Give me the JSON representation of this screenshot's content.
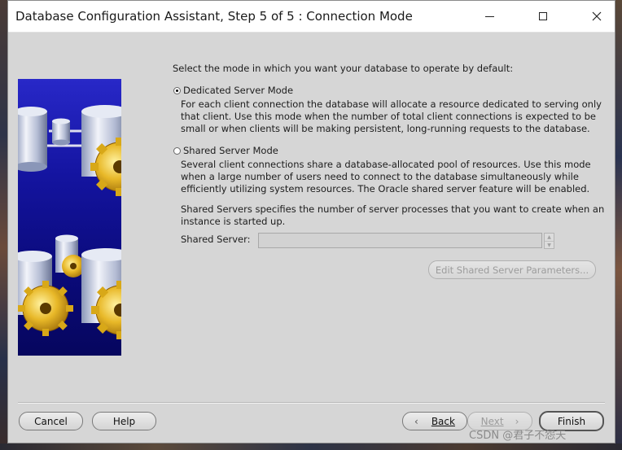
{
  "window": {
    "title": "Database Configuration Assistant, Step 5 of 5 : Connection Mode"
  },
  "main": {
    "prompt": "Select the mode in which you want your database to operate by default:",
    "dedicated": {
      "label": "Dedicated Server Mode",
      "selected": true,
      "description": [
        "For each client connection the database will allocate a resource dedicated to serving only",
        "that client.  Use this mode when the number of total client connections is expected to be",
        "small or when clients will be making persistent, long-running requests to the database."
      ]
    },
    "shared": {
      "label": "Shared Server Mode",
      "selected": false,
      "description": [
        "Several client connections share a database-allocated pool of resources.  Use this mode",
        "when a large number of users need to connect to the database simultaneously while",
        "efficiently utilizing system resources.  The Oracle shared server feature will be enabled."
      ]
    },
    "shared_servers_info": [
      "Shared Servers specifies the number of server processes that you want to create when an",
      "instance is started up."
    ],
    "shared_server_label": "Shared Server:",
    "shared_server_value": "",
    "edit_params_label": "Edit Shared Server Parameters..."
  },
  "footer": {
    "cancel": "Cancel",
    "help": "Help",
    "back": "Back",
    "next": "Next",
    "finish": "Finish"
  },
  "watermark": "CSDN @君子不怨天",
  "colors": {
    "panel_blue": "#1414a0",
    "gear_gold": "#e0b020",
    "dialog_bg": "#d6d6d6"
  }
}
